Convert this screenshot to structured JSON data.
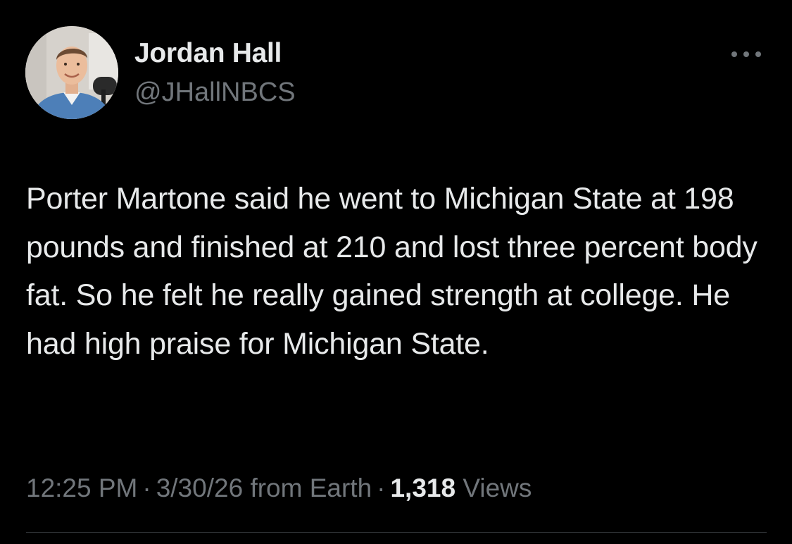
{
  "author": {
    "display_name": "Jordan Hall",
    "handle": "@JHallNBCS",
    "avatar_icon": "profile-photo"
  },
  "more_icon": "ellipsis-icon",
  "tweet": {
    "text": "Porter Martone said he went to Michigan State at 198 pounds and finished at 210 and lost three percent body fat. So he felt he really gained strength at college. He had high praise for Michigan State."
  },
  "meta": {
    "time": "12:25 PM",
    "separator": "·",
    "date": "3/30/26",
    "source": "from Earth",
    "views_count": "1,318",
    "views_label": "Views"
  },
  "colors": {
    "background": "#000000",
    "primary_text": "#e7e9ea",
    "secondary_text": "#71767b",
    "divider": "#2f3336"
  }
}
